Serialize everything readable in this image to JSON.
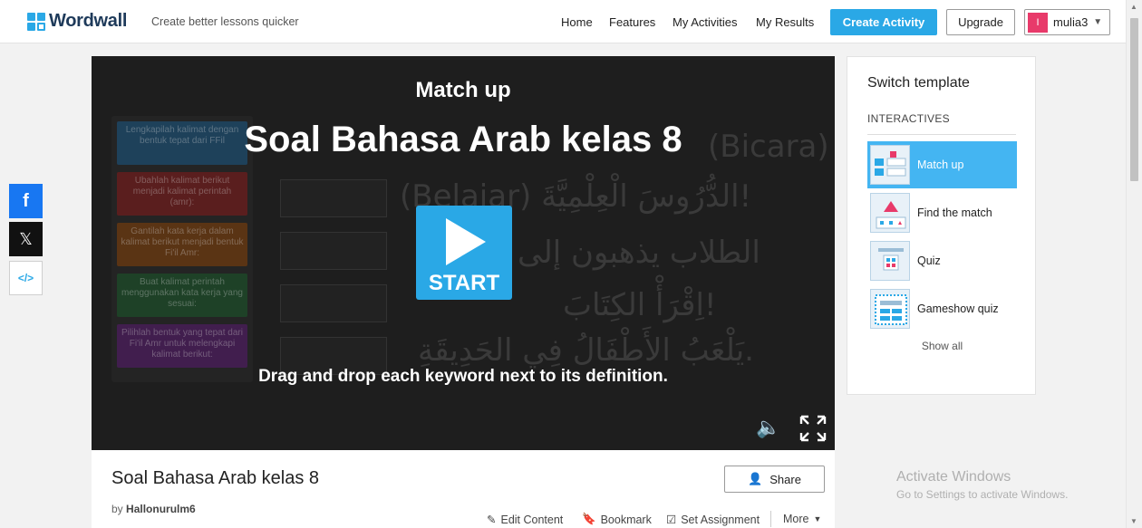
{
  "header": {
    "logo_text": "Wordwall",
    "tagline": "Create better lessons quicker",
    "nav": [
      "Home",
      "Features",
      "My Activities",
      "My Results"
    ],
    "create_label": "Create Activity",
    "upgrade_label": "Upgrade",
    "user_initial": "I",
    "user_name": "mulia3"
  },
  "social": {
    "facebook": "f",
    "x": "𝕏",
    "embed": "</>"
  },
  "game": {
    "type": "Match up",
    "title": "Soal Bahasa Arab kelas 8",
    "start_label": "START",
    "instructions": "Drag and drop each keyword next to its definition.",
    "bg_cards": [
      "Lengkapilah kalimat dengan bentuk tepat dari FFil",
      "Ubahlah kalimat berikut menjadi kalimat perintah (amr):",
      "Gantilah kata kerja dalam kalimat berikut menjadi bentuk Fi'il Amr:",
      "Buat kalimat perintah menggunakan kata kerja yang sesuai:",
      "Pilihlah bentuk yang tepat dari Fi'il Amr untuk melengkapi kalimat berikut:"
    ],
    "bg_texts": [
      "(Bicara)",
      "(Belajar) الدُّرُوسَ الْعِلْمِيَّةَ!",
      "الطلاب يذهبون إلى",
      "اِقْرَأْ الكِتَابَ!",
      "يَلْعَبُ الأَطْفَالُ فِي الحَدِيقَةِ."
    ]
  },
  "activity": {
    "title": "Soal Bahasa Arab kelas 8",
    "by_label": "by",
    "author": "Hallonurulm6",
    "share_label": "Share",
    "actions": [
      "Edit Content",
      "Bookmark",
      "Set Assignment",
      "More"
    ]
  },
  "templates": {
    "title": "Switch template",
    "section": "INTERACTIVES",
    "items": [
      "Match up",
      "Find the match",
      "Quiz",
      "Gameshow quiz"
    ],
    "show_all": "Show all"
  },
  "watermark": {
    "line1": "Activate Windows",
    "line2": "Go to Settings to activate Windows."
  }
}
